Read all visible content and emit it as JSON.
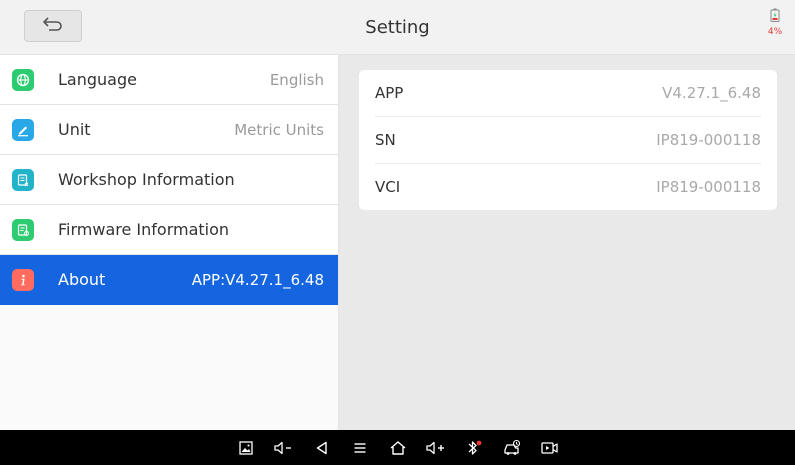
{
  "header": {
    "title": "Setting",
    "battery_percent": "4%"
  },
  "sidebar": {
    "items": [
      {
        "label": "Language",
        "value": "English",
        "icon": "globe-icon",
        "active": false
      },
      {
        "label": "Unit",
        "value": "Metric Units",
        "icon": "pencil-icon",
        "active": false
      },
      {
        "label": "Workshop Information",
        "value": "",
        "icon": "document-icon",
        "active": false
      },
      {
        "label": "Firmware Information",
        "value": "",
        "icon": "firmware-icon",
        "active": false
      },
      {
        "label": "About",
        "value": "APP:V4.27.1_6.48",
        "icon": "info-icon",
        "active": true
      }
    ]
  },
  "main": {
    "rows": [
      {
        "key": "APP",
        "value": "V4.27.1_6.48"
      },
      {
        "key": "SN",
        "value": "IP819-000118"
      },
      {
        "key": "VCI",
        "value": "IP819-000118"
      }
    ]
  },
  "navbar": {
    "items": [
      "screenshot-icon",
      "volume-down-icon",
      "back-icon",
      "menu-icon",
      "home-icon",
      "volume-up-icon",
      "bluetooth-icon",
      "car-diagnostic-icon",
      "screen-record-icon"
    ]
  },
  "colors": {
    "accent": "#1565e0",
    "battery_low": "#e53935"
  }
}
